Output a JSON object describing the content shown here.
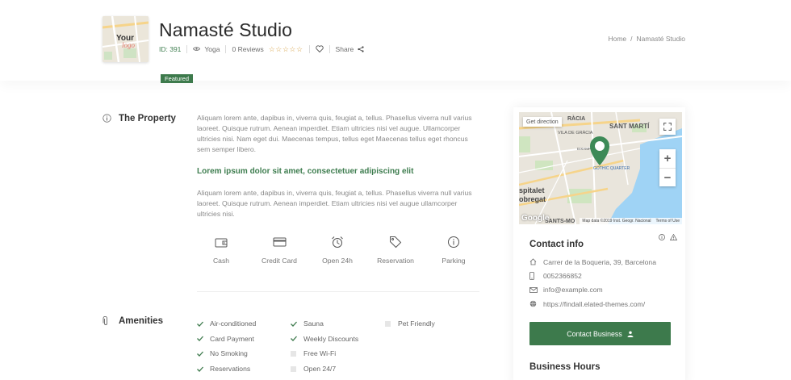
{
  "header": {
    "logo_text_1": "Your",
    "logo_text_2": "logo",
    "title": "Namasté Studio",
    "id_label": "ID: 391",
    "category": "Yoga",
    "reviews": "0 Reviews",
    "rating_stars": "☆☆☆☆☆",
    "share_label": "Share",
    "featured_badge": "Featured"
  },
  "breadcrumb": {
    "home": "Home",
    "separator": "/",
    "current": "Namasté Studio"
  },
  "property": {
    "title": "The Property",
    "paragraph_1": "Aliquam lorem ante, dapibus in, viverra quis, feugiat a, tellus. Phasellus viverra null varius laoreet. Quisque rutrum. Aenean imperdiet. Etiam ultricies nisi vel augue. Ullamcorper ultricies nisi. Nam eget dui. Maecenas tempus, tellus eget Maecenas tellus eget rhoncus sem semper libero.",
    "subheading": "Lorem ipsum dolor sit amet, consectetuer adipiscing elit",
    "paragraph_2": "Aliquam lorem ante, dapibus in, viverra quis, feugiat a, tellus. Phasellus viverra null varius laoreet. Quisque rutrum. Aenean imperdiet. Etiam ultricies nisi vel augue ullamcorper ultricies nisi."
  },
  "features": [
    {
      "label": "Cash",
      "icon": "wallet-icon"
    },
    {
      "label": "Credit Card",
      "icon": "credit-card-icon"
    },
    {
      "label": "Open 24h",
      "icon": "alarm-clock-icon"
    },
    {
      "label": "Reservation",
      "icon": "tag-icon"
    },
    {
      "label": "Parking",
      "icon": "info-circle-icon"
    }
  ],
  "amenities": {
    "title": "Amenities",
    "columns": [
      [
        {
          "label": "Air-conditioned",
          "checked": true
        },
        {
          "label": "Card Payment",
          "checked": true
        },
        {
          "label": "No Smoking",
          "checked": true
        },
        {
          "label": "Reservations",
          "checked": true
        }
      ],
      [
        {
          "label": "Sauna",
          "checked": true
        },
        {
          "label": "Weekly Discounts",
          "checked": true
        },
        {
          "label": "Free Wi-Fi",
          "checked": false
        },
        {
          "label": "Open 24/7",
          "checked": false
        }
      ],
      [
        {
          "label": "Pet Friendly",
          "checked": false
        }
      ]
    ]
  },
  "map": {
    "get_direction": "Get direction",
    "zoom_in": "+",
    "zoom_out": "−",
    "labels": {
      "gracia": "RÀCIA",
      "vila_de_gracia": "VILA DE GRÀCIA",
      "sant_marti": "SANT MARTÍ",
      "eixample": "EIXAMPLE",
      "gothic_quarter": "GOTHIC QUARTER",
      "hospitalet": "spitalet",
      "llobregat": "obregat",
      "sants": "SANTS-MO"
    },
    "google": "Google",
    "attribution": "Map data ©2019 Inst. Geogr. Nacional",
    "terms": "Terms of Use"
  },
  "contact": {
    "title": "Contact info",
    "address": "Carrer de la Boqueria, 39, Barcelona",
    "phone": "0052366852",
    "email": "info@example.com",
    "website": "https://findall.elated-themes.com/",
    "button_label": "Contact Business"
  },
  "business_hours": {
    "title": "Business Hours"
  },
  "colors": {
    "accent": "#3d7a4c",
    "star": "#d8a54d",
    "text_muted": "#8a8a8a"
  }
}
